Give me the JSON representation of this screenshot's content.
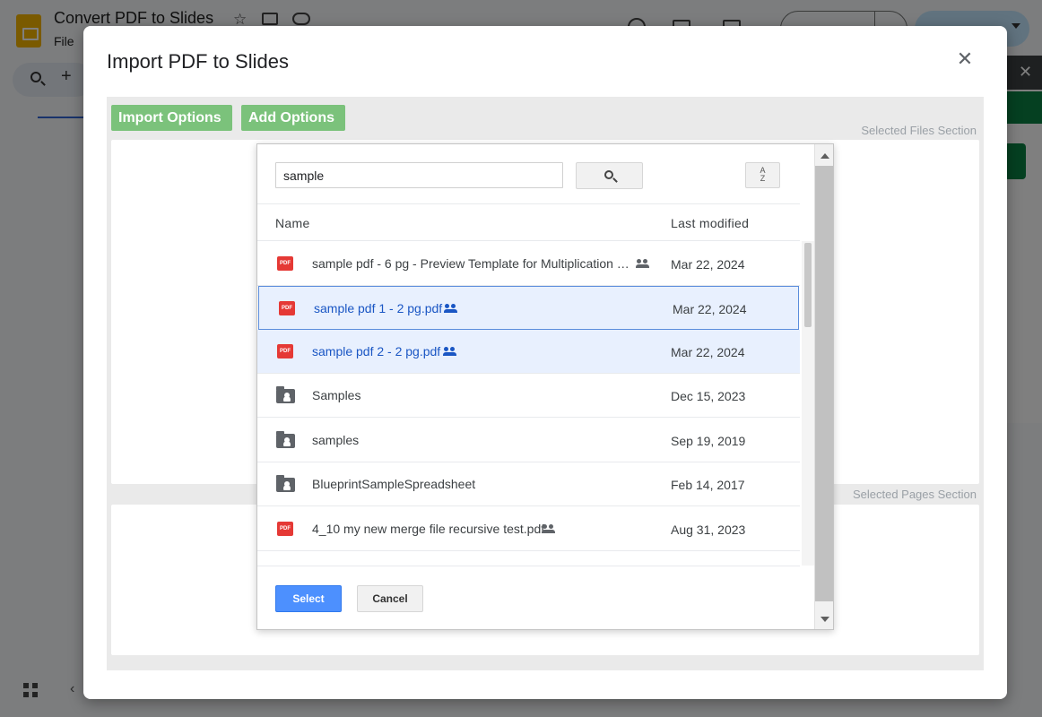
{
  "app": {
    "doc_title": "Convert PDF to Slides",
    "menu_file": "File"
  },
  "dialog": {
    "title": "Import PDF to Slides",
    "import_options_label": "Import Options",
    "add_options_label": "Add Options",
    "selected_files_label": "Selected Files Section",
    "selected_pages_label": "Selected Pages Section"
  },
  "picker": {
    "search_value": "sample",
    "sort_label_top": "A",
    "sort_label_bottom": "Z",
    "col_name": "Name",
    "col_modified": "Last modified",
    "files": [
      {
        "name": "sample pdf - 6 pg - Preview Template for Multiplication Decimals.pdf",
        "type": "pdf",
        "shared": true,
        "modified": "Mar 22, 2024",
        "selected": false
      },
      {
        "name": "sample pdf 1 - 2 pg.pdf",
        "type": "pdf",
        "shared": true,
        "modified": "Mar 22, 2024",
        "selected": true
      },
      {
        "name": "sample pdf 2 - 2 pg.pdf",
        "type": "pdf",
        "shared": true,
        "modified": "Mar 22, 2024",
        "selected": true
      },
      {
        "name": "Samples",
        "type": "shared-folder",
        "shared": false,
        "modified": "Dec 15, 2023",
        "selected": false
      },
      {
        "name": "samples",
        "type": "shared-folder",
        "shared": false,
        "modified": "Sep 19, 2019",
        "selected": false
      },
      {
        "name": "BlueprintSampleSpreadsheet",
        "type": "shared-folder",
        "shared": false,
        "modified": "Feb 14, 2017",
        "selected": false
      },
      {
        "name": "4_10 my new merge file recursive test.pdf",
        "type": "pdf",
        "shared": true,
        "modified": "Aug 31, 2023",
        "selected": false
      }
    ],
    "select_label": "Select",
    "cancel_label": "Cancel",
    "pdf_badge": "PDF"
  }
}
